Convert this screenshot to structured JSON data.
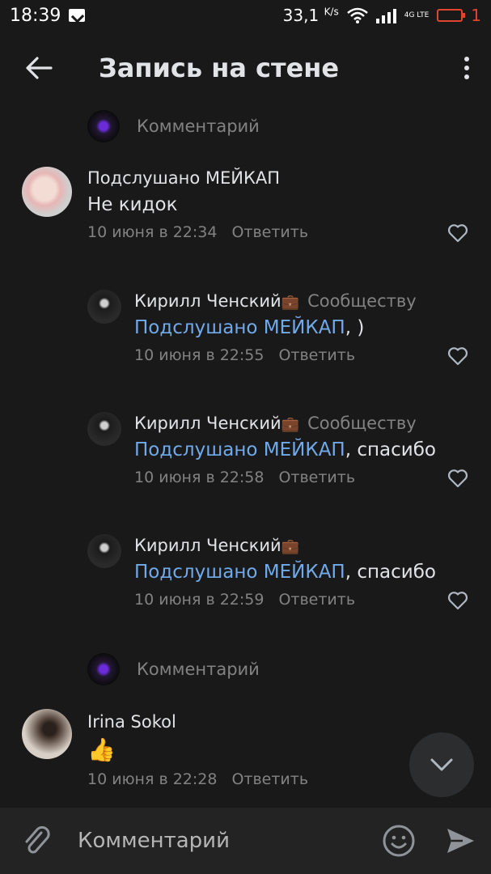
{
  "status_bar": {
    "time": "18:39",
    "net_speed": "33,1",
    "net_unit": "K/s",
    "network": "4G LTE",
    "battery": "1",
    "battery_color": "#e0452e"
  },
  "header": {
    "back_icon": "arrow-left-icon",
    "title": "Запись на стене",
    "menu_icon": "more-vertical-icon"
  },
  "colors": {
    "background": "#191919",
    "text": "#e1e3e6",
    "secondary": "#828282",
    "link": "#71aaeb"
  },
  "reply_prompts": [
    {
      "label": "Комментарий"
    },
    {
      "label": "Комментарий"
    }
  ],
  "comments": [
    {
      "author": "Подслушано МЕЙКАП",
      "badge": "",
      "to": "",
      "mention": "",
      "text": "Не кидок",
      "date": "10 июня в 22:34",
      "reply": "Ответить"
    },
    {
      "author": "Кирилл Ченский",
      "badge": "💼",
      "to": "Сообществу",
      "mention": "Подслушано МЕЙКАП",
      "text": ", )",
      "date": "10 июня в 22:55",
      "reply": "Ответить"
    },
    {
      "author": "Кирилл Ченский",
      "badge": "💼",
      "to": "Сообществу",
      "mention": "Подслушано МЕЙКАП",
      "text": ", спасибо",
      "date": "10 июня в 22:58",
      "reply": "Ответить"
    },
    {
      "author": "Кирилл Ченский",
      "badge": "💼",
      "to": "",
      "mention": "Подслушано МЕЙКАП",
      "text": ", спасибо",
      "date": "10 июня в 22:59",
      "reply": "Ответить"
    },
    {
      "author": "Irina Sokol",
      "badge": "",
      "to": "",
      "mention": "",
      "text": "👍",
      "date": "10 июня в 22:28",
      "reply": "Ответить"
    }
  ],
  "composer": {
    "attach_icon": "paperclip-icon",
    "placeholder": "Комментарий",
    "emoji_icon": "emoji-icon",
    "send_icon": "send-icon"
  },
  "scroll_button_icon": "chevron-down-icon"
}
